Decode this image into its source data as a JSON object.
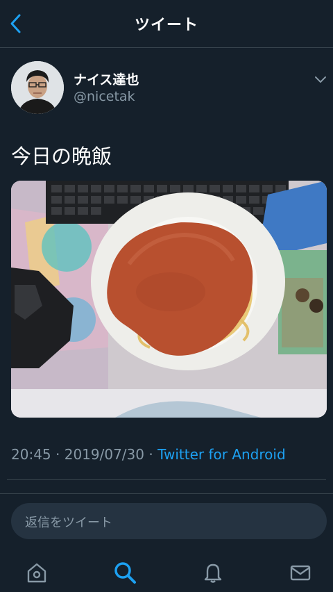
{
  "header": {
    "title": "ツイート",
    "back_icon": "chevron-left-icon"
  },
  "author": {
    "display_name": "ナイス達也",
    "handle": "@nicetak",
    "menu_icon": "chevron-down-icon"
  },
  "tweet": {
    "text": "今日の晩飯",
    "time": "20:45",
    "separator": " · ",
    "date": "2019/07/30",
    "source": "Twitter for Android"
  },
  "reply": {
    "placeholder": "返信をツイート"
  },
  "tabbar": {
    "items": [
      {
        "icon": "home-icon",
        "active": false
      },
      {
        "icon": "search-icon",
        "active": true
      },
      {
        "icon": "notifications-bell-icon",
        "active": false
      },
      {
        "icon": "messages-envelope-icon",
        "active": false
      }
    ]
  },
  "colors": {
    "background": "#15202b",
    "accent": "#1da1f2",
    "secondary_text": "#8899a6",
    "border": "#38444d"
  }
}
